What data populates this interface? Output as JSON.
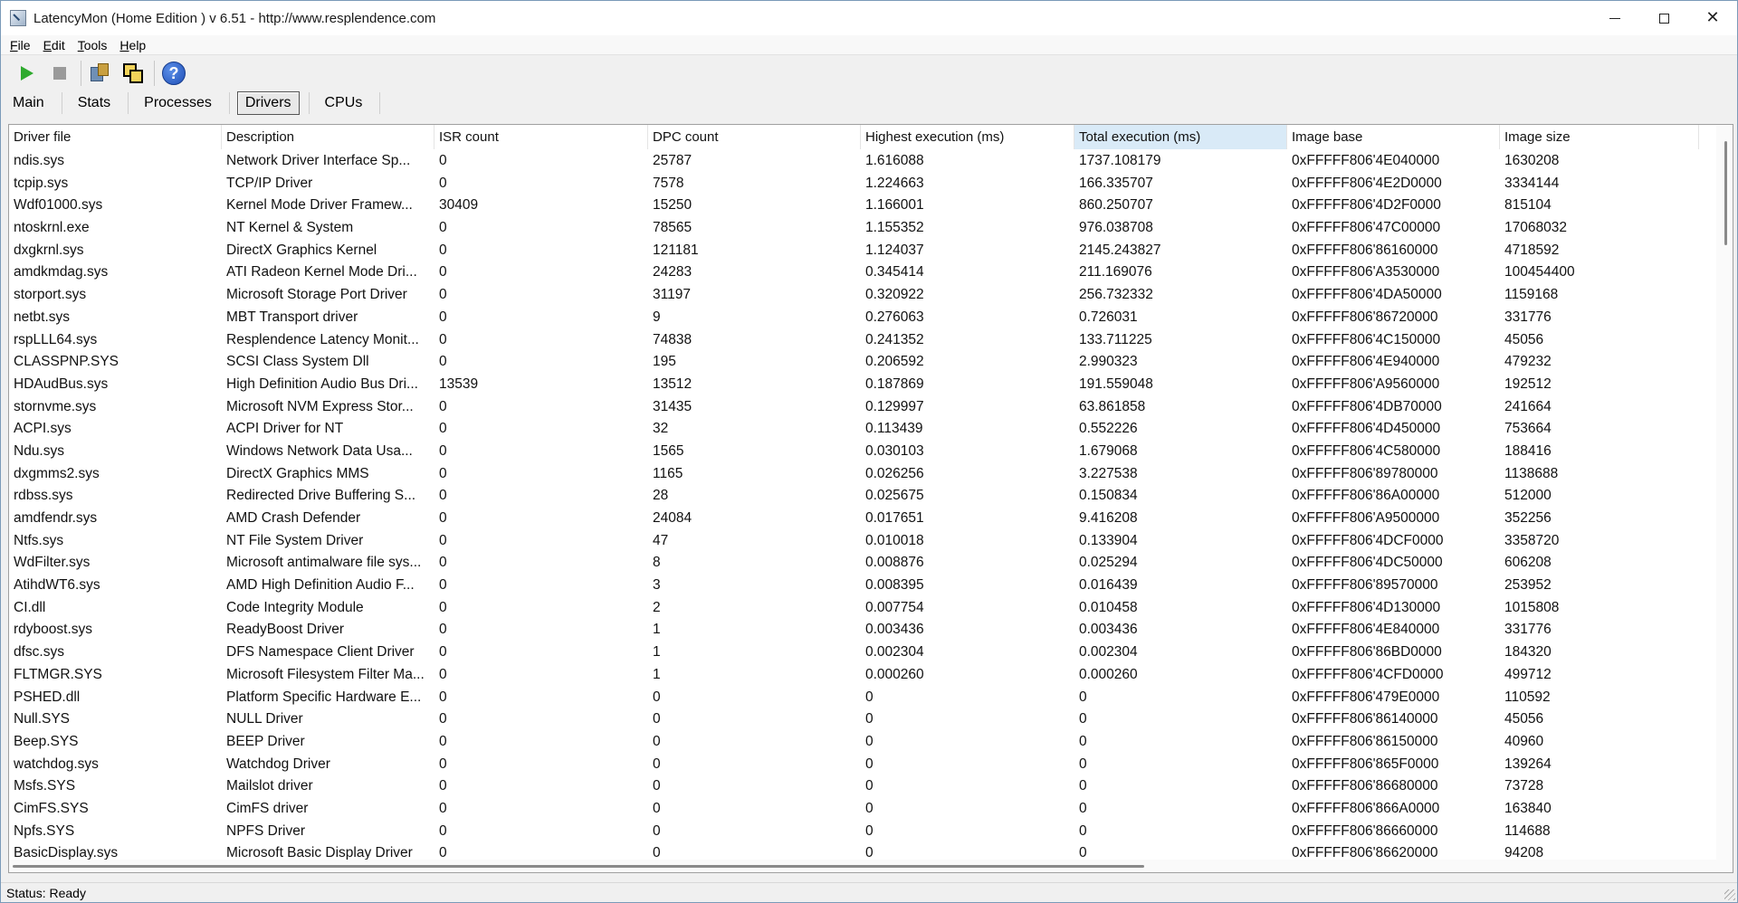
{
  "window": {
    "title": "LatencyMon  (Home Edition )  v 6.51 - http://www.resplendence.com"
  },
  "menu": [
    {
      "label": "File",
      "accel": "F",
      "rest": "ile"
    },
    {
      "label": "Edit",
      "accel": "E",
      "rest": "dit"
    },
    {
      "label": "Tools",
      "accel": "T",
      "rest": "ools"
    },
    {
      "label": "Help",
      "accel": "H",
      "rest": "elp"
    }
  ],
  "toolbar": {
    "icons": [
      "play-icon",
      "stop-icon",
      "tools-icon",
      "copy-icon",
      "help-icon"
    ],
    "help_glyph": "?"
  },
  "tabs": [
    {
      "label": "Main",
      "active": false
    },
    {
      "label": "Stats",
      "active": false
    },
    {
      "label": "Processes",
      "active": false
    },
    {
      "label": "Drivers",
      "active": true
    },
    {
      "label": "CPUs",
      "active": false
    }
  ],
  "table": {
    "columns": [
      "Driver file",
      "Description",
      "ISR count",
      "DPC count",
      "Highest execution (ms)",
      "Total execution (ms)",
      "Image base",
      "Image size"
    ],
    "sorted_column": "Total execution (ms)",
    "rows": [
      [
        "ndis.sys",
        "Network Driver Interface Sp...",
        "0",
        "25787",
        "1.616088",
        "1737.108179",
        "0xFFFFF806'4E040000",
        "1630208"
      ],
      [
        "tcpip.sys",
        "TCP/IP Driver",
        "0",
        "7578",
        "1.224663",
        "166.335707",
        "0xFFFFF806'4E2D0000",
        "3334144"
      ],
      [
        "Wdf01000.sys",
        "Kernel Mode Driver Framew...",
        "30409",
        "15250",
        "1.166001",
        "860.250707",
        "0xFFFFF806'4D2F0000",
        "815104"
      ],
      [
        "ntoskrnl.exe",
        "NT Kernel & System",
        "0",
        "78565",
        "1.155352",
        "976.038708",
        "0xFFFFF806'47C00000",
        "17068032"
      ],
      [
        "dxgkrnl.sys",
        "DirectX Graphics Kernel",
        "0",
        "121181",
        "1.124037",
        "2145.243827",
        "0xFFFFF806'86160000",
        "4718592"
      ],
      [
        "amdkmdag.sys",
        "ATI Radeon Kernel Mode Dri...",
        "0",
        "24283",
        "0.345414",
        "211.169076",
        "0xFFFFF806'A3530000",
        "100454400"
      ],
      [
        "storport.sys",
        "Microsoft Storage Port Driver",
        "0",
        "31197",
        "0.320922",
        "256.732332",
        "0xFFFFF806'4DA50000",
        "1159168"
      ],
      [
        "netbt.sys",
        "MBT Transport driver",
        "0",
        "9",
        "0.276063",
        "0.726031",
        "0xFFFFF806'86720000",
        "331776"
      ],
      [
        "rspLLL64.sys",
        "Resplendence Latency Monit...",
        "0",
        "74838",
        "0.241352",
        "133.711225",
        "0xFFFFF806'4C150000",
        "45056"
      ],
      [
        "CLASSPNP.SYS",
        "SCSI Class System Dll",
        "0",
        "195",
        "0.206592",
        "2.990323",
        "0xFFFFF806'4E940000",
        "479232"
      ],
      [
        "HDAudBus.sys",
        "High Definition Audio Bus Dri...",
        "13539",
        "13512",
        "0.187869",
        "191.559048",
        "0xFFFFF806'A9560000",
        "192512"
      ],
      [
        "stornvme.sys",
        "Microsoft NVM Express Stor...",
        "0",
        "31435",
        "0.129997",
        "63.861858",
        "0xFFFFF806'4DB70000",
        "241664"
      ],
      [
        "ACPI.sys",
        "ACPI Driver for NT",
        "0",
        "32",
        "0.113439",
        "0.552226",
        "0xFFFFF806'4D450000",
        "753664"
      ],
      [
        "Ndu.sys",
        "Windows Network Data Usa...",
        "0",
        "1565",
        "0.030103",
        "1.679068",
        "0xFFFFF806'4C580000",
        "188416"
      ],
      [
        "dxgmms2.sys",
        "DirectX Graphics MMS",
        "0",
        "1165",
        "0.026256",
        "3.227538",
        "0xFFFFF806'89780000",
        "1138688"
      ],
      [
        "rdbss.sys",
        "Redirected Drive Buffering S...",
        "0",
        "28",
        "0.025675",
        "0.150834",
        "0xFFFFF806'86A00000",
        "512000"
      ],
      [
        "amdfendr.sys",
        "AMD Crash Defender",
        "0",
        "24084",
        "0.017651",
        "9.416208",
        "0xFFFFF806'A9500000",
        "352256"
      ],
      [
        "Ntfs.sys",
        "NT File System Driver",
        "0",
        "47",
        "0.010018",
        "0.133904",
        "0xFFFFF806'4DCF0000",
        "3358720"
      ],
      [
        "WdFilter.sys",
        "Microsoft antimalware file sys...",
        "0",
        "8",
        "0.008876",
        "0.025294",
        "0xFFFFF806'4DC50000",
        "606208"
      ],
      [
        "AtihdWT6.sys",
        "AMD High Definition Audio F...",
        "0",
        "3",
        "0.008395",
        "0.016439",
        "0xFFFFF806'89570000",
        "253952"
      ],
      [
        "CI.dll",
        "Code Integrity Module",
        "0",
        "2",
        "0.007754",
        "0.010458",
        "0xFFFFF806'4D130000",
        "1015808"
      ],
      [
        "rdyboost.sys",
        "ReadyBoost Driver",
        "0",
        "1",
        "0.003436",
        "0.003436",
        "0xFFFFF806'4E840000",
        "331776"
      ],
      [
        "dfsc.sys",
        "DFS Namespace Client Driver",
        "0",
        "1",
        "0.002304",
        "0.002304",
        "0xFFFFF806'86BD0000",
        "184320"
      ],
      [
        "FLTMGR.SYS",
        "Microsoft Filesystem Filter Ma...",
        "0",
        "1",
        "0.000260",
        "0.000260",
        "0xFFFFF806'4CFD0000",
        "499712"
      ],
      [
        "PSHED.dll",
        "Platform Specific Hardware E...",
        "0",
        "0",
        "0",
        "0",
        "0xFFFFF806'479E0000",
        "110592"
      ],
      [
        "Null.SYS",
        "NULL Driver",
        "0",
        "0",
        "0",
        "0",
        "0xFFFFF806'86140000",
        "45056"
      ],
      [
        "Beep.SYS",
        "BEEP Driver",
        "0",
        "0",
        "0",
        "0",
        "0xFFFFF806'86150000",
        "40960"
      ],
      [
        "watchdog.sys",
        "Watchdog Driver",
        "0",
        "0",
        "0",
        "0",
        "0xFFFFF806'865F0000",
        "139264"
      ],
      [
        "Msfs.SYS",
        "Mailslot driver",
        "0",
        "0",
        "0",
        "0",
        "0xFFFFF806'86680000",
        "73728"
      ],
      [
        "CimFS.SYS",
        "CimFS driver",
        "0",
        "0",
        "0",
        "0",
        "0xFFFFF806'866A0000",
        "163840"
      ],
      [
        "Npfs.SYS",
        "NPFS Driver",
        "0",
        "0",
        "0",
        "0",
        "0xFFFFF806'86660000",
        "114688"
      ],
      [
        "BasicDisplay.sys",
        "Microsoft Basic Display Driver",
        "0",
        "0",
        "0",
        "0",
        "0xFFFFF806'86620000",
        "94208"
      ]
    ]
  },
  "status": {
    "text": "Status: Ready"
  }
}
